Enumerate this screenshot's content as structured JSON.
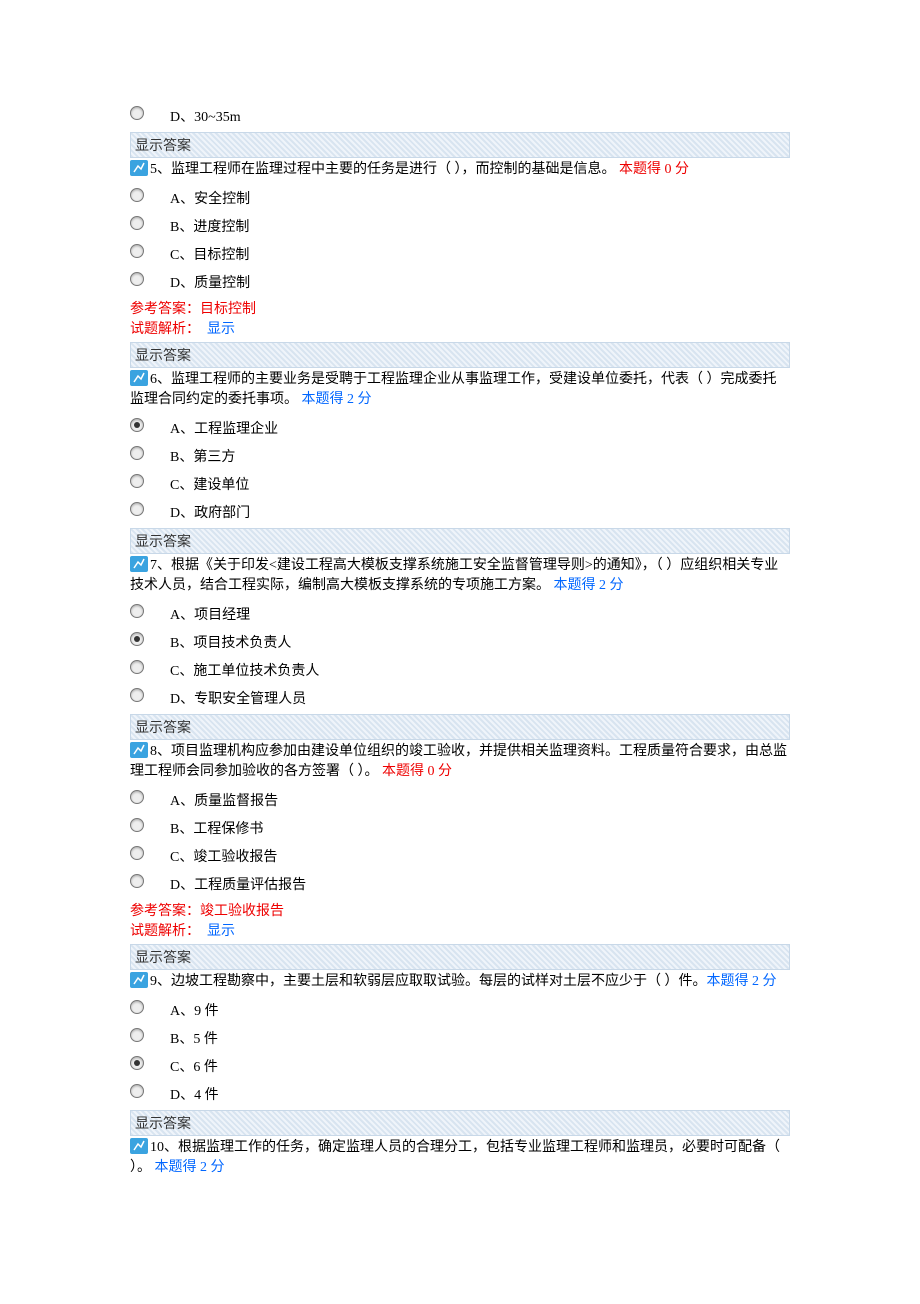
{
  "labels": {
    "show_answer": "显示答案",
    "answer_ref": "参考答案：",
    "analysis": "试题解析：",
    "show": "显示",
    "score_prefix": "本题得 ",
    "score_suffix": " 分"
  },
  "prev_option": {
    "letter": "D",
    "text": "30~35m"
  },
  "questions": [
    {
      "num": "5",
      "text": "、监理工程师在监理过程中主要的任务是进行（ ），而控制的基础是信息。",
      "score": "0",
      "score_class": "red",
      "options": [
        {
          "letter": "A",
          "text": "安全控制",
          "checked": false
        },
        {
          "letter": "B",
          "text": "进度控制",
          "checked": false
        },
        {
          "letter": "C",
          "text": "目标控制",
          "checked": false
        },
        {
          "letter": "D",
          "text": "质量控制",
          "checked": false
        }
      ],
      "answer": "目标控制",
      "show_analysis": true
    },
    {
      "num": "6",
      "text": "、监理工程师的主要业务是受聘于工程监理企业从事监理工作，受建设单位委托，代表（ ）完成委托监理合同约定的委托事项。",
      "score": "2",
      "score_class": "blue",
      "options": [
        {
          "letter": "A",
          "text": "工程监理企业",
          "checked": true
        },
        {
          "letter": "B",
          "text": "第三方",
          "checked": false
        },
        {
          "letter": "C",
          "text": "建设单位",
          "checked": false
        },
        {
          "letter": "D",
          "text": "政府部门",
          "checked": false
        }
      ],
      "answer": null
    },
    {
      "num": "7",
      "text": "、根据《关于印发<建设工程高大模板支撑系统施工安全监督管理导则>的通知》，（ ）应组织相关专业技术人员，结合工程实际，编制高大模板支撑系统的专项施工方案。",
      "score": "2",
      "score_class": "blue",
      "options": [
        {
          "letter": "A",
          "text": "项目经理",
          "checked": false
        },
        {
          "letter": "B",
          "text": "项目技术负责人",
          "checked": true
        },
        {
          "letter": "C",
          "text": "施工单位技术负责人",
          "checked": false
        },
        {
          "letter": "D",
          "text": "专职安全管理人员",
          "checked": false
        }
      ],
      "answer": null
    },
    {
      "num": "8",
      "text": "、项目监理机构应参加由建设单位组织的竣工验收，并提供相关监理资料。工程质量符合要求，由总监理工程师会同参加验收的各方签署（ ）。",
      "score": "0",
      "score_class": "red",
      "options": [
        {
          "letter": "A",
          "text": "质量监督报告",
          "checked": false
        },
        {
          "letter": "B",
          "text": "工程保修书",
          "checked": false
        },
        {
          "letter": "C",
          "text": "竣工验收报告",
          "checked": false
        },
        {
          "letter": "D",
          "text": "工程质量评估报告",
          "checked": false
        }
      ],
      "answer": "竣工验收报告",
      "show_analysis": true
    },
    {
      "num": "9",
      "text": "、边坡工程勘察中，主要土层和软弱层应取取试验。每层的试样对土层不应少于（ ）件。",
      "score": "2",
      "score_class": "blue",
      "score_inline": true,
      "options": [
        {
          "letter": "A",
          "text": "9 件",
          "checked": false
        },
        {
          "letter": "B",
          "text": "5 件",
          "checked": false
        },
        {
          "letter": "C",
          "text": "6 件",
          "checked": true
        },
        {
          "letter": "D",
          "text": "4 件",
          "checked": false
        }
      ],
      "answer": null
    },
    {
      "num": "10",
      "text": "、根据监理工作的任务，确定监理人员的合理分工，包括专业监理工程师和监理员，必要时可配备（ ）。",
      "score": "2",
      "score_class": "blue",
      "options": [],
      "answer": null
    }
  ]
}
